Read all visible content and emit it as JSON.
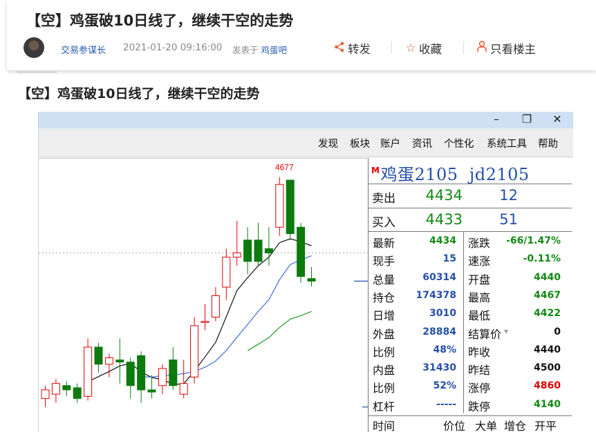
{
  "post": {
    "title": "【空】鸡蛋破10日线了，继续干空的走势",
    "author": "交易参谋长",
    "datetime": "2021-01-20 09:16:00",
    "posted_in_prefix": "发表于",
    "forum": "鸡蛋吧",
    "actions": {
      "share": "转发",
      "favorite": "收藏",
      "op_only": "只看楼主"
    },
    "body_title": "【空】鸡蛋破10日线了，继续干空的走势"
  },
  "window": {
    "controls": {
      "minimize": "–",
      "restore": "❐",
      "close": "✕"
    },
    "menu": [
      "发现",
      "板块",
      "账户",
      "资讯",
      "个性化",
      "系统工具",
      "帮助"
    ]
  },
  "chart_data": {
    "type": "candlestick",
    "annotations": [
      "4677"
    ],
    "candles": [
      {
        "o": 4160,
        "c": 4180,
        "h": 4190,
        "l": 4140
      },
      {
        "o": 4170,
        "c": 4195,
        "h": 4205,
        "l": 4150
      },
      {
        "o": 4190,
        "c": 4180,
        "h": 4200,
        "l": 4165
      },
      {
        "o": 4185,
        "c": 4160,
        "h": 4195,
        "l": 4150
      },
      {
        "o": 4165,
        "c": 4280,
        "h": 4300,
        "l": 4155
      },
      {
        "o": 4280,
        "c": 4240,
        "h": 4290,
        "l": 4220
      },
      {
        "o": 4240,
        "c": 4255,
        "h": 4265,
        "l": 4210
      },
      {
        "o": 4250,
        "c": 4245,
        "h": 4300,
        "l": 4195
      },
      {
        "o": 4245,
        "c": 4190,
        "h": 4255,
        "l": 4160
      },
      {
        "o": 4260,
        "c": 4180,
        "h": 4270,
        "l": 4150
      },
      {
        "o": 4180,
        "c": 4175,
        "h": 4215,
        "l": 4160
      },
      {
        "o": 4190,
        "c": 4230,
        "h": 4240,
        "l": 4170
      },
      {
        "o": 4250,
        "c": 4190,
        "h": 4280,
        "l": 4180
      },
      {
        "o": 4170,
        "c": 4195,
        "h": 4250,
        "l": 4160
      },
      {
        "o": 4210,
        "c": 4330,
        "h": 4350,
        "l": 4195
      },
      {
        "o": 4340,
        "c": 4340,
        "h": 4380,
        "l": 4320
      },
      {
        "o": 4350,
        "c": 4400,
        "h": 4420,
        "l": 4340
      },
      {
        "o": 4420,
        "c": 4490,
        "h": 4510,
        "l": 4390
      },
      {
        "o": 4490,
        "c": 4500,
        "h": 4575,
        "l": 4470
      },
      {
        "o": 4530,
        "c": 4480,
        "h": 4560,
        "l": 4450
      },
      {
        "o": 4530,
        "c": 4480,
        "h": 4570,
        "l": 4470
      },
      {
        "o": 4510,
        "c": 4500,
        "h": 4560,
        "l": 4470
      },
      {
        "o": 4560,
        "c": 4660,
        "h": 4677,
        "l": 4540
      },
      {
        "o": 4670,
        "c": 4545,
        "h": 4670,
        "l": 4530
      },
      {
        "o": 4560,
        "c": 4445,
        "h": 4570,
        "l": 4430
      },
      {
        "o": 4440,
        "c": 4434,
        "h": 4467,
        "l": 4422
      }
    ]
  },
  "quote": {
    "flag": "M",
    "name": "鸡蛋2105",
    "code": "jd2105",
    "sell": {
      "label": "卖出",
      "price": "4434",
      "vol": "12"
    },
    "buy": {
      "label": "买入",
      "price": "4433",
      "vol": "51"
    },
    "rows": [
      {
        "l1": "最新",
        "v1": "4434",
        "c1": "#128a12",
        "l2": "涨跌",
        "v2": "-66/1.47%",
        "c2": "#128a12"
      },
      {
        "l1": "现手",
        "v1": "15",
        "c1": "#2550a8",
        "l2": "速涨",
        "v2": "-0.11%",
        "c2": "#128a12"
      },
      {
        "l1": "总量",
        "v1": "60314",
        "c1": "#2550a8",
        "l2": "开盘",
        "v2": "4440",
        "c2": "#128a12"
      },
      {
        "l1": "持仓",
        "v1": "174378",
        "c1": "#2550a8",
        "l2": "最高",
        "v2": "4467",
        "c2": "#128a12"
      },
      {
        "l1": "日增",
        "v1": "3010",
        "c1": "#2550a8",
        "l2": "最低",
        "v2": "4422",
        "c2": "#128a12"
      },
      {
        "l1": "外盘",
        "v1": "28884",
        "c1": "#2550a8",
        "l2": "结算价",
        "v2": "0",
        "c2": "#111111"
      },
      {
        "l1": "比例",
        "v1": "48%",
        "c1": "#2550a8",
        "l2": "昨收",
        "v2": "4440",
        "c2": "#111111"
      },
      {
        "l1": "内盘",
        "v1": "31430",
        "c1": "#2550a8",
        "l2": "昨结",
        "v2": "4500",
        "c2": "#111111"
      },
      {
        "l1": "比例",
        "v1": "52%",
        "c1": "#2550a8",
        "l2": "涨停",
        "v2": "4860",
        "c2": "#e00000"
      },
      {
        "l1": "杠杆",
        "v1": "-----",
        "c1": "#2550a8",
        "l2": "跌停",
        "v2": "4140",
        "c2": "#128a12"
      }
    ],
    "tick_headers": [
      "时间",
      "价位",
      "大单",
      "增仓",
      "开平"
    ]
  },
  "colors": {
    "up": "#e00000",
    "down": "#0d7a0d",
    "ma_black": "#111111",
    "ma_blue": "#3a6fd8",
    "ma_green": "#1e9a1e"
  }
}
